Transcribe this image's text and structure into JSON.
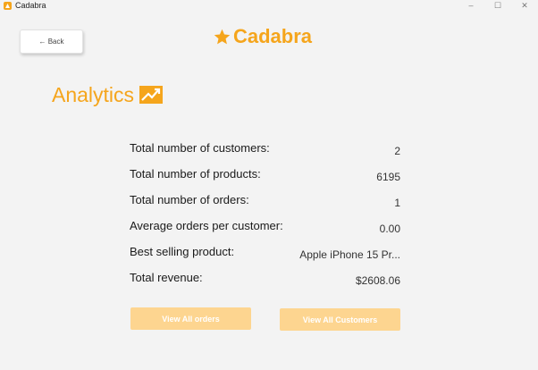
{
  "window": {
    "title": "Cadabra",
    "controls": {
      "minimize": "–",
      "maximize": "☐",
      "close": "✕"
    }
  },
  "header": {
    "back_label": "← Back",
    "logo_text": "Cadabra",
    "logo_icon": "star-icon"
  },
  "section": {
    "title": "Analytics",
    "icon": "trending-chart-icon"
  },
  "stats": [
    {
      "label": "Total number of customers:",
      "value": "2"
    },
    {
      "label": "Total number of products:",
      "value": "6195"
    },
    {
      "label": "Total number of orders:",
      "value": "1"
    },
    {
      "label": "Average orders per customer:",
      "value": "0.00"
    },
    {
      "label": "Best selling product:",
      "value": "Apple iPhone 15 Pr..."
    },
    {
      "label": "Total revenue:",
      "value": "$2608.06"
    }
  ],
  "actions": {
    "view_orders": "View All orders",
    "view_customers": "View All Customers"
  },
  "colors": {
    "brand": "#f5a51c",
    "button_bg": "#fdd590",
    "background": "#f3f3f3"
  }
}
